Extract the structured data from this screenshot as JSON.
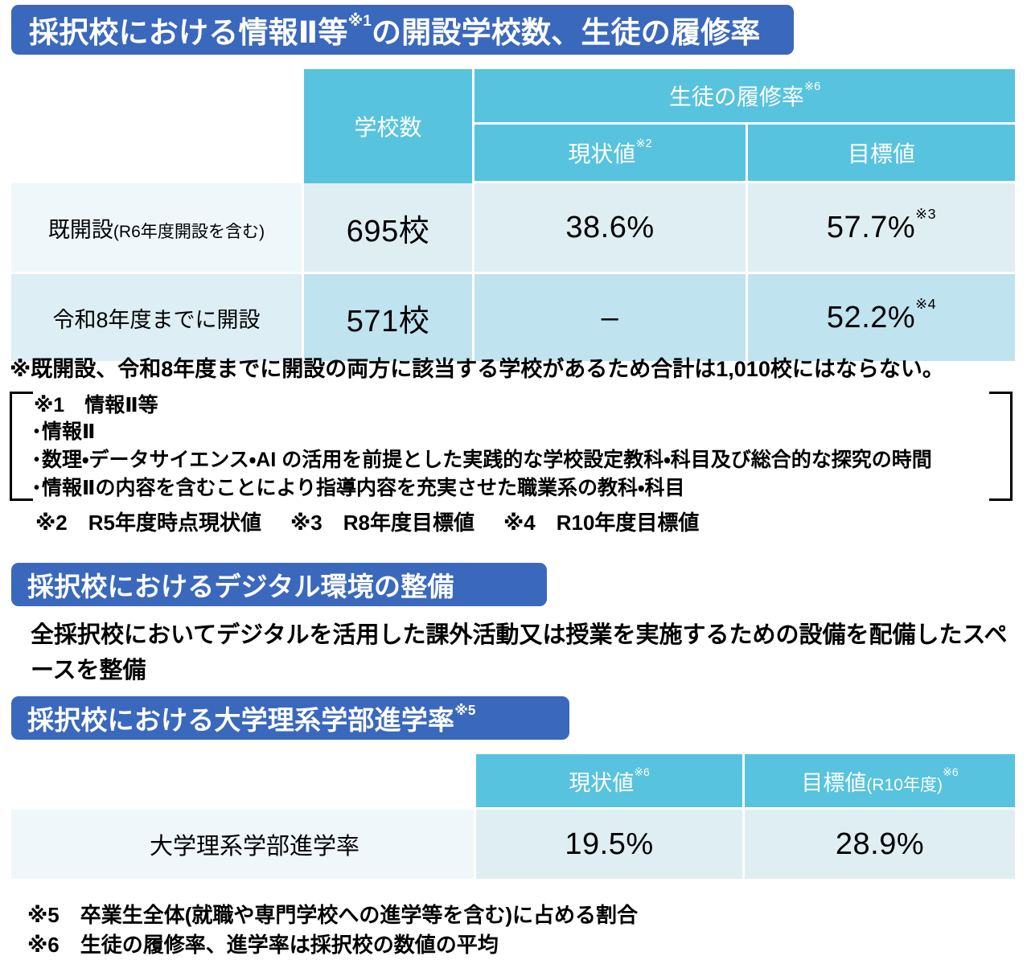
{
  "sections": {
    "heading1": {
      "text": "採択校における情報Ⅱ等",
      "sup": "※1",
      "text_after": "の開設学校数、生徒の履修率"
    },
    "heading2": {
      "text": "採択校におけるデジタル環境の整備"
    },
    "heading3": {
      "text": "採択校における大学理系学部進学率",
      "sup": "※5"
    }
  },
  "table1": {
    "headers": {
      "corner": "",
      "school_count": "学校数",
      "enrollment_group": "生徒の履修率",
      "enrollment_group_sup": "※6",
      "current": "現状値",
      "current_sup": "※2",
      "target": "目標値"
    },
    "rows": [
      {
        "label": "既開設",
        "label_paren": "(R6年度開設を含む)",
        "school_count": "695校",
        "current": "38.6%",
        "target": "57.7%",
        "target_sup": "※3"
      },
      {
        "label": "令和8年度までに開設",
        "label_paren": "",
        "school_count": "571校",
        "current": "–",
        "target": "52.2%",
        "target_sup": "※4"
      }
    ]
  },
  "notes": {
    "total_note": "※既開設、令和8年度までに開設の両方に該当する学校があるため合計は1,010校にはならない。",
    "bracket_block": {
      "title": "※1　情報Ⅱ等",
      "items": [
        "情報Ⅱ",
        "数理・データサイエンス・AI の活用を前提とした実践的な学校設定教科・科目及び総合的な探究の時間",
        "情報Ⅱの内容を含むことにより指導内容を充実させた職業系の教科・科目"
      ]
    },
    "note2": "※2　R5年度時点現状値",
    "note3": "※3　R8年度目標値",
    "note4": "※4　R10年度目標値",
    "note5": "※5　卒業生全体(就職や専門学校への進学等を含む)に占める割合",
    "note6": "※6　生徒の履修率、進学率は採択校の数値の平均"
  },
  "digital_section": {
    "body": "全採択校においてデジタルを活用した課外活動又は授業を実施するための設備を配備したスペースを整備"
  },
  "table2": {
    "headers": {
      "corner": "",
      "current": "現状値",
      "current_sup": "※6",
      "target": "目標値",
      "target_paren": "(R10年度)",
      "target_sup": "※6"
    },
    "rows": [
      {
        "label": "大学理系学部進学率",
        "current": "19.5%",
        "target": "28.9%"
      }
    ]
  },
  "colors": {
    "badge_blue": "#3a68bc",
    "header_teal": "#58c3de",
    "row_light": "#f0f7fb",
    "row_light_value": "#dfeef3",
    "row_dark": "#ddeef5",
    "row_dark_value": "#bfe3ef"
  }
}
